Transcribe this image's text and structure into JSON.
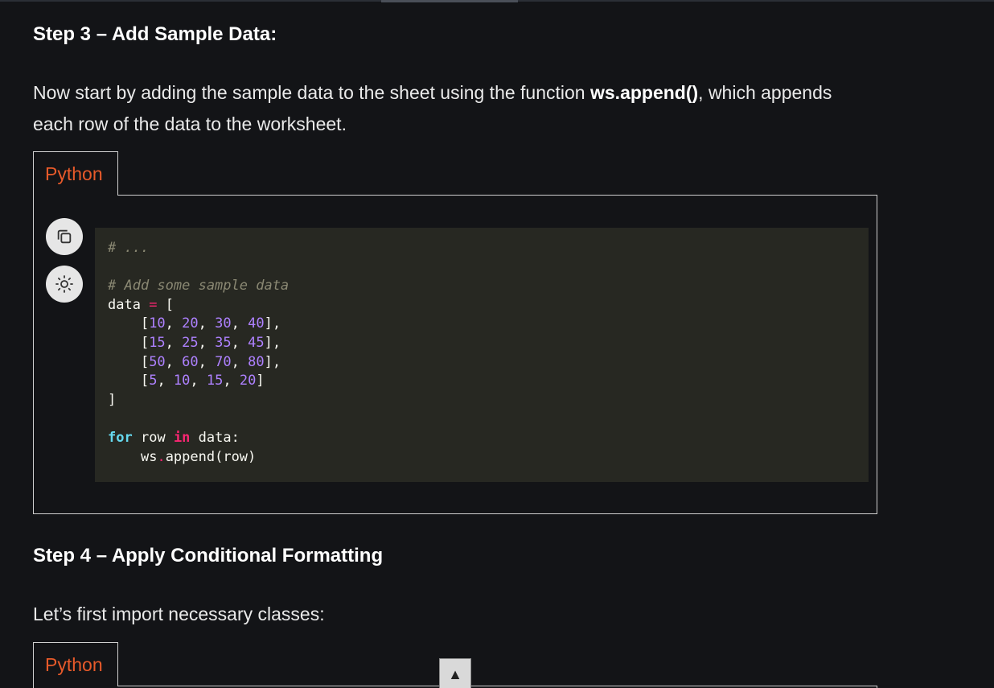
{
  "step3": {
    "heading": "Step 3 – Add Sample Data:",
    "para_before": "Now start by adding the sample data to the sheet using the function ",
    "para_bold": "ws.append()",
    "para_after": ", which appends each row of the data to the worksheet."
  },
  "code1": {
    "tab_label": "Python",
    "copy_icon": "copy-icon",
    "theme_icon": "sun-icon",
    "lines": {
      "l1": "# ...",
      "l2": "# Add some sample data",
      "l3_var": "data",
      "l3_op": "=",
      "l3_br": "[",
      "row1": [
        "10",
        "20",
        "30",
        "40"
      ],
      "row2": [
        "15",
        "25",
        "35",
        "45"
      ],
      "row3": [
        "50",
        "60",
        "70",
        "80"
      ],
      "row4": [
        "5",
        "10",
        "15",
        "20"
      ],
      "close": "]",
      "for_kw": "for",
      "for_var": "row",
      "in_kw": "in",
      "for_iter": "data:",
      "call_obj": "ws",
      "call_dot": ".",
      "call_rest": "append(row)"
    }
  },
  "step4": {
    "heading": "Step 4 – Apply Conditional Formatting",
    "para": "Let’s first import necessary classes:"
  },
  "code2": {
    "tab_label": "Python"
  },
  "scroll_top": {
    "glyph": "▲"
  }
}
